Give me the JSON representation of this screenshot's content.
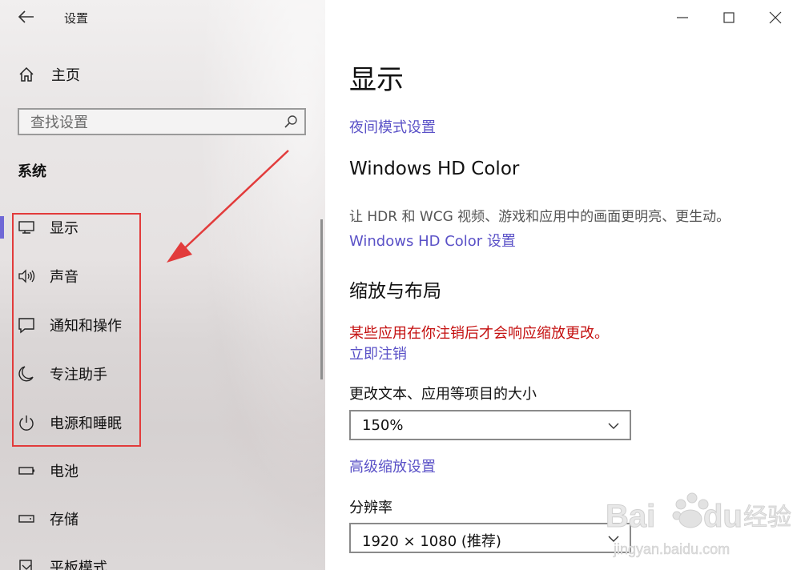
{
  "window": {
    "title": "设置",
    "controls": [
      "minimize-icon",
      "maximize-icon",
      "close-icon"
    ]
  },
  "sidebar": {
    "home_label": "主页",
    "search": {
      "placeholder": "查找设置",
      "value": ""
    },
    "section_title": "系统",
    "items": [
      {
        "label": "显示",
        "icon": "monitor-icon",
        "active": true
      },
      {
        "label": "声音",
        "icon": "speaker-icon",
        "active": false
      },
      {
        "label": "通知和操作",
        "icon": "notification-icon",
        "active": false
      },
      {
        "label": "专注助手",
        "icon": "moon-icon",
        "active": false
      },
      {
        "label": "电源和睡眠",
        "icon": "power-icon",
        "active": false
      },
      {
        "label": "电池",
        "icon": "battery-icon",
        "active": false
      },
      {
        "label": "存储",
        "icon": "storage-icon",
        "active": false
      },
      {
        "label": "平板模式",
        "icon": "tablet-icon",
        "active": false
      }
    ]
  },
  "main": {
    "title": "显示",
    "night_light_link": "夜间模式设置",
    "hd_color": {
      "heading": "Windows HD Color",
      "description": "让 HDR 和 WCG 视频、游戏和应用中的画面更明亮、更生动。",
      "link": "Windows HD Color 设置"
    },
    "scale_layout": {
      "heading": "缩放与布局",
      "warning": "某些应用在你注销后才会响应缩放更改。",
      "signout_link": "立即注销",
      "size_label": "更改文本、应用等项目的大小",
      "size_value": "150%",
      "advanced_link": "高级缩放设置",
      "resolution_label": "分辨率",
      "resolution_value": "1920 × 1080 (推荐)"
    }
  },
  "watermark": {
    "brand": "Baidu",
    "brand_cn": "经验",
    "url": "jingyan.baidu.com"
  },
  "colors": {
    "accent": "#5a51c7",
    "active_indicator": "#7068d6",
    "warning": "#c40f0f",
    "annotation": "#e23b3b"
  }
}
